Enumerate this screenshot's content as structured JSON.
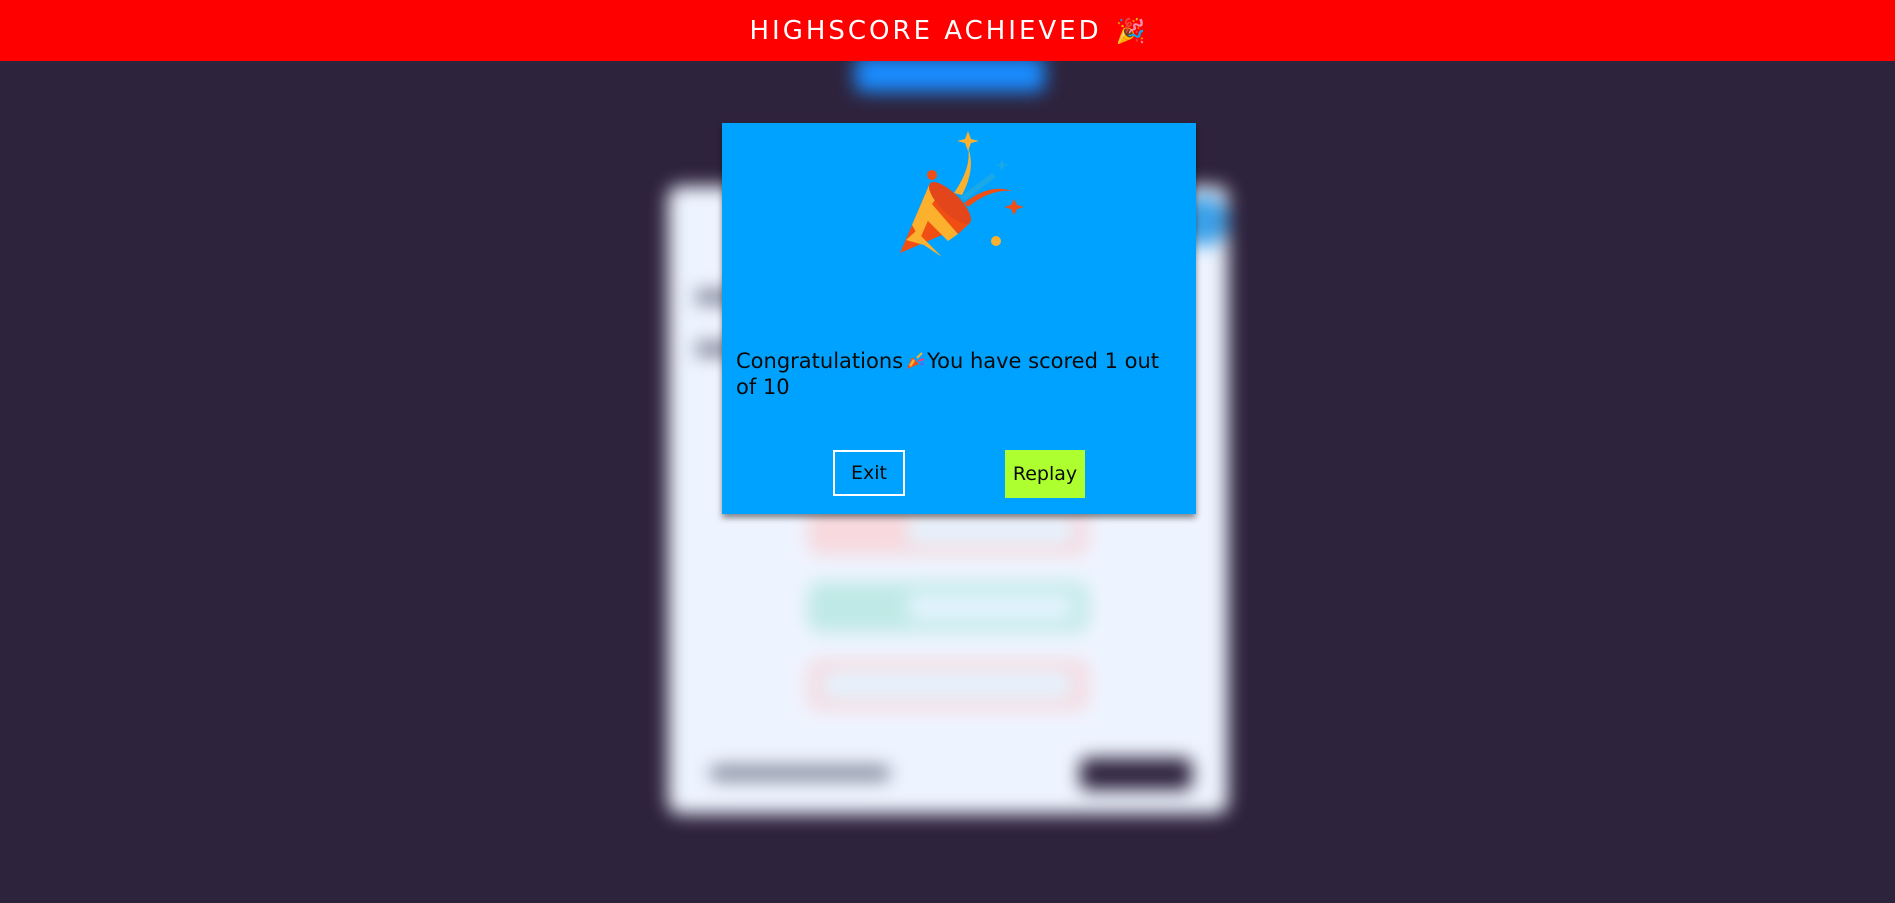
{
  "banner": {
    "title": "HIGHSCORE ACHIEVED",
    "emoji": "🎉",
    "background_color": "#ff0000"
  },
  "modal": {
    "icon": "party-popper-icon",
    "message_before_icon": "Congratulations",
    "message_icon": "party-popper-icon",
    "message_after_icon": "You have scored 1 out of 10",
    "exit_label": "Exit",
    "replay_label": "Replay",
    "background_color": "#00a2ff",
    "replay_color": "#adff2f"
  },
  "colors": {
    "page_background": "#2e233d",
    "card_background": "#eef4ff",
    "accent_blue": "#1a8cff"
  }
}
